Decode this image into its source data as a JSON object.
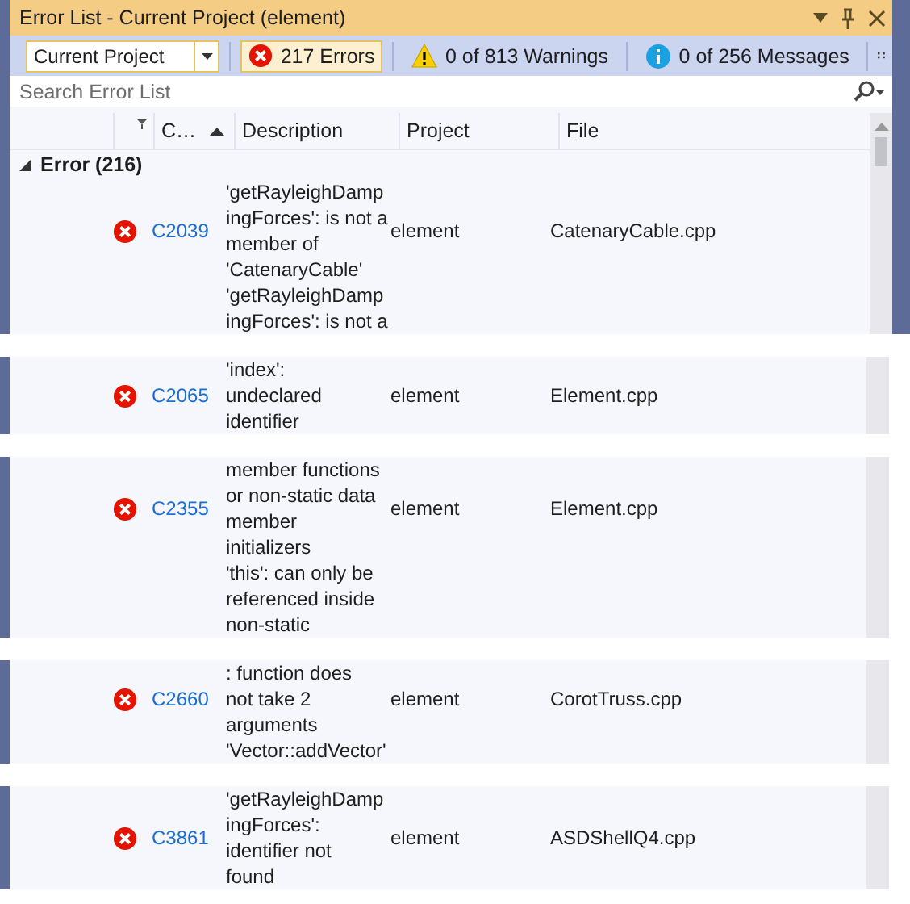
{
  "title": "Error List - Current Project (element)",
  "scope": {
    "value": "Current Project"
  },
  "filters": [
    {
      "kind": "error",
      "label": "217 Errors",
      "selected": true
    },
    {
      "kind": "warning",
      "label": "0 of 813 Warnings",
      "selected": false
    },
    {
      "kind": "info",
      "label": "0 of 256 Messages",
      "selected": false
    }
  ],
  "search": {
    "placeholder": "Search Error List"
  },
  "columns": [
    "C…",
    "Description",
    "Project",
    "File"
  ],
  "group": {
    "label": "Error (216)",
    "expanded": true
  },
  "strips": [
    {
      "rows": [
        {
          "kind": "error",
          "code": "C2039",
          "description": [
            "'getRayleighDamp",
            "ingForces': is not a",
            "member of",
            "'CatenaryCable'"
          ],
          "project": "element",
          "file": "CatenaryCable.cpp"
        },
        {
          "description": [
            "'getRayleighDamp",
            "ingForces': is not a"
          ]
        }
      ]
    },
    {
      "rows": [
        {
          "kind": "error",
          "code": "C2065",
          "description": [
            "'index':",
            "undeclared",
            "identifier"
          ],
          "project": "element",
          "file": "Element.cpp"
        }
      ]
    },
    {
      "rows": [
        {
          "kind": "error",
          "code": "C2355",
          "description": [
            "member functions",
            "or non-static data",
            "member",
            "initializers"
          ],
          "project": "element",
          "file": "Element.cpp"
        },
        {
          "description": [
            "'this': can only be",
            "referenced inside",
            "non-static"
          ]
        }
      ]
    },
    {
      "rows": [
        {
          "kind": "error",
          "code": "C2660",
          "description": [
            ": function does",
            "not take 2",
            "arguments"
          ],
          "project": "element",
          "file": "CorotTruss.cpp"
        },
        {
          "description": [
            "'Vector::addVector'"
          ]
        }
      ]
    },
    {
      "rows": [
        {
          "kind": "error",
          "code": "C3861",
          "description": [
            "'getRayleighDamp",
            "ingForces':",
            "identifier not",
            "found"
          ],
          "project": "element",
          "file": "ASDShellQ4.cpp"
        }
      ]
    }
  ]
}
